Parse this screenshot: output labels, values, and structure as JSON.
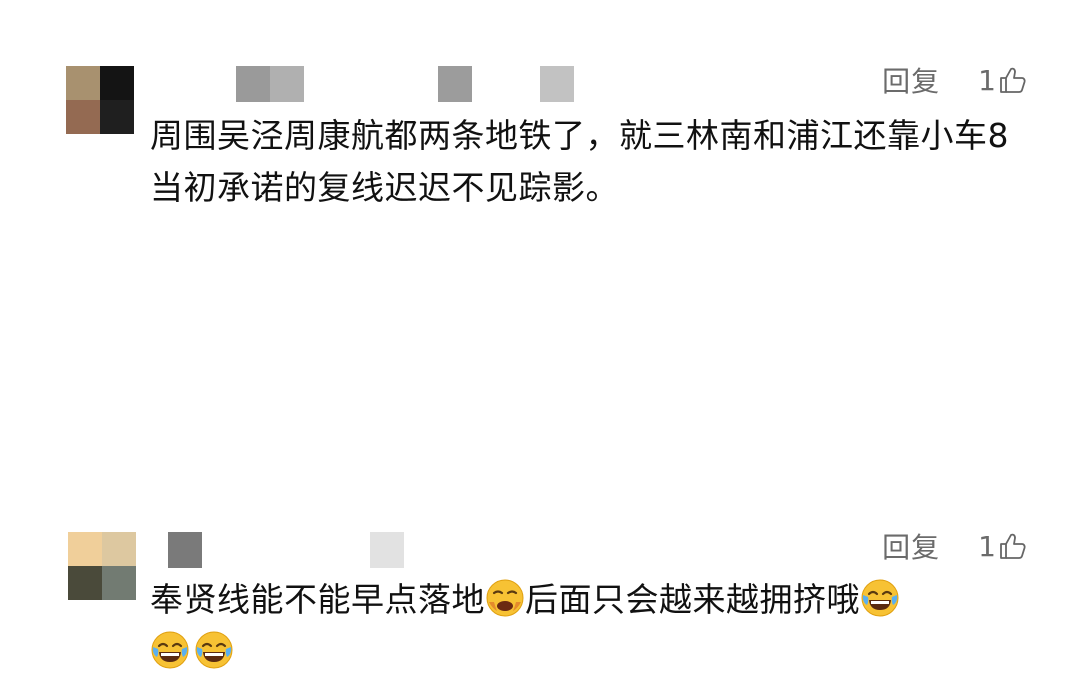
{
  "comments": [
    {
      "text": "周围吴泾周康航都两条地铁了，就三林南和浦江还靠小车8当初承诺的复线迟迟不见踪影。",
      "reply_label": "回复",
      "like_count": "1",
      "avatar_colors": [
        "#a8916f",
        "#141414",
        "#946a52",
        "#1f1f1f"
      ],
      "name_block_colors": [
        "#9a9a9a",
        "#b0b0b0",
        "#9c9c9c",
        "#c2c2c2"
      ]
    },
    {
      "text_before_emoji": "奉贤线能不能早点落地",
      "text_after_emoji": "后面只会越来越拥挤哦",
      "reply_label": "回复",
      "like_count": "1",
      "avatar_colors": [
        "#f0cf9a",
        "#ddc8a0",
        "#4a4a3a",
        "#727b72"
      ],
      "name_block_colors": [
        "#7a7a7a",
        "#e2e2e2"
      ],
      "emojis": [
        "weary-face",
        "tears-of-joy",
        "tears-of-joy",
        "tears-of-joy"
      ]
    }
  ]
}
